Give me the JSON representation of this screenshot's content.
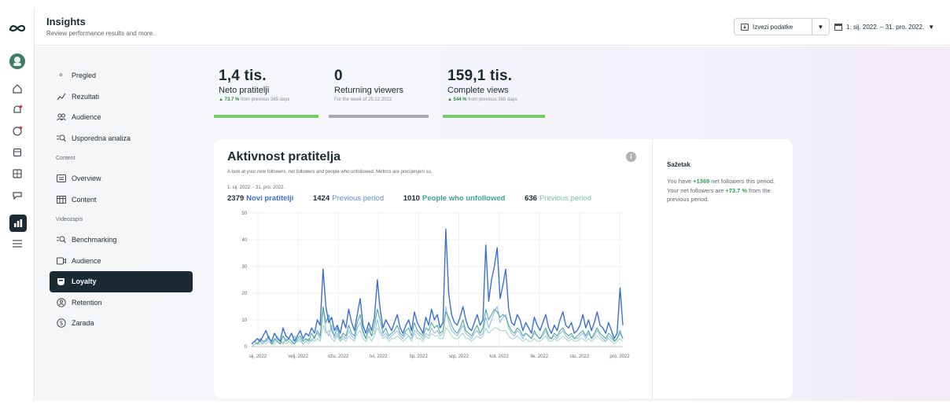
{
  "header": {
    "title": "Insights",
    "subtitle": "Review performance results and more.",
    "export_label": "Izvezi podatke",
    "date_range": "1. sij. 2022. – 31. pro. 2022."
  },
  "rail": {
    "icons": [
      "meta-logo-icon",
      "avatar",
      "home-icon",
      "notifications-icon",
      "chat-icon",
      "posts-icon",
      "content-icon",
      "inbox-icon",
      "insights-icon",
      "menu-icon"
    ]
  },
  "nav": {
    "items": [
      {
        "label": "Pregled",
        "icon": "overview-icon"
      },
      {
        "label": "Rezultati",
        "icon": "results-icon"
      },
      {
        "label": "Audience",
        "icon": "audience-icon"
      },
      {
        "label": "Usporedna analiza",
        "icon": "benchmark-icon"
      }
    ],
    "section_content": "Content",
    "content_items": [
      {
        "label": "Overview",
        "icon": "overview-icon"
      },
      {
        "label": "Content",
        "icon": "table-icon"
      }
    ],
    "section_video": "Videozapis",
    "video_items": [
      {
        "label": "Benchmarking",
        "icon": "benchmark-icon"
      },
      {
        "label": "Audience",
        "icon": "video-audience-icon"
      },
      {
        "label": "Loyalty",
        "icon": "loyalty-icon",
        "active": true
      },
      {
        "label": "Retention",
        "icon": "retention-icon"
      },
      {
        "label": "Zarada",
        "icon": "dollar-icon"
      }
    ]
  },
  "stats": [
    {
      "value": "1,4 tis.",
      "label": "Neto pratitelji",
      "change": "73.7 %",
      "sub": " from previous 365 days",
      "bar_color": "#7bc96f"
    },
    {
      "value": "0",
      "label": "Returning viewers",
      "change": "",
      "sub": "For the week of 25.12.2022",
      "bar_color": "#a7a9ac"
    },
    {
      "value": "159,1 tis.",
      "label": "Complete views",
      "change": "544 %",
      "sub": " from previous 365 days",
      "bar_color": "#7bc96f"
    }
  ],
  "card": {
    "title": "Aktivnost pratitelja",
    "description": "A look at your new followers, net followers and people who unfollowed. Metrics are procijenjeni su.",
    "range": "1. sij. 2022. - 31. pro. 2022.",
    "legend": [
      {
        "value": "2379",
        "label": "Novi pratitelji"
      },
      {
        "value": "1424",
        "label": "Previous period"
      },
      {
        "value": "1010",
        "label": "People who unfollowed"
      },
      {
        "value": "636",
        "label": "Previous period"
      }
    ],
    "info_glyph": "i"
  },
  "summary": {
    "title": "Sažetak",
    "text_1": "You have ",
    "hl_1": "+1369",
    "text_2": " net followers this period. Your net followers are ",
    "hl_2": "+73.7 %",
    "text_3": " from the previous period."
  },
  "chart_data": {
    "type": "line",
    "x": [
      "sij. 2022",
      "velj. 2022",
      "ožu. 2022",
      "tvi. 2022",
      "lip. 2022",
      "srp. 2022",
      "kol. 2022",
      "ile. 2022",
      "stu. 2022",
      "pro. 2022"
    ],
    "ylim": [
      0,
      50
    ],
    "yticks": [
      0,
      10,
      20,
      30,
      40,
      50
    ],
    "grid": true,
    "series": [
      {
        "name": "Novi pratitelji",
        "color": "#3b6fd4",
        "values": [
          1,
          2,
          3,
          2,
          4,
          6,
          3,
          2,
          5,
          3,
          2,
          7,
          4,
          3,
          5,
          2,
          4,
          6,
          3,
          5,
          4,
          7,
          5,
          10,
          8,
          29,
          15,
          9,
          11,
          6,
          8,
          5,
          10,
          7,
          14,
          9,
          6,
          12,
          18,
          8,
          5,
          9,
          6,
          11,
          25,
          14,
          7,
          10,
          8,
          6,
          9,
          12,
          7,
          5,
          8,
          10,
          6,
          13,
          9,
          7,
          5,
          11,
          8,
          14,
          10,
          12,
          7,
          9,
          44,
          20,
          12,
          9,
          8,
          11,
          15,
          10,
          7,
          6,
          9,
          12,
          8,
          10,
          38,
          17,
          25,
          30,
          37,
          18,
          23,
          29,
          14,
          9,
          8,
          12,
          10,
          6,
          9,
          7,
          5,
          11,
          8,
          6,
          9,
          12,
          7,
          5,
          8,
          6,
          10,
          13,
          8,
          7,
          9,
          5,
          6,
          8,
          12,
          7,
          10,
          6,
          9,
          13,
          8,
          7,
          5,
          9,
          6,
          3,
          5,
          22,
          8
        ]
      },
      {
        "name": "Previous period",
        "color": "#8fb4ea",
        "values": [
          0,
          1,
          1,
          2,
          1,
          3,
          2,
          1,
          2,
          4,
          2,
          1,
          3,
          2,
          1,
          4,
          2,
          3,
          1,
          2,
          3,
          2,
          4,
          5,
          3,
          14,
          6,
          4,
          8,
          3,
          5,
          2,
          4,
          3,
          6,
          4,
          3,
          7,
          9,
          5,
          3,
          6,
          4,
          5,
          10,
          6,
          4,
          5,
          3,
          4,
          5,
          6,
          4,
          3,
          5,
          4,
          3,
          6,
          5,
          4,
          3,
          5,
          4,
          7,
          5,
          6,
          4,
          5,
          15,
          9,
          6,
          5,
          4,
          6,
          8,
          5,
          4,
          3,
          5,
          6,
          4,
          5,
          11,
          7,
          10,
          13,
          15,
          9,
          11,
          12,
          7,
          5,
          4,
          6,
          5,
          3,
          5,
          4,
          3,
          5,
          4,
          3,
          4,
          6,
          3,
          3,
          4,
          3,
          5,
          6,
          4,
          3,
          4,
          3,
          3,
          4,
          5,
          3,
          5,
          3,
          4,
          6,
          4,
          3,
          2,
          4,
          3,
          2,
          3,
          5,
          3
        ]
      },
      {
        "name": "People who unfollowed",
        "color": "#3aa38c",
        "values": [
          1,
          2,
          1,
          3,
          2,
          2,
          4,
          1,
          3,
          2,
          1,
          4,
          2,
          3,
          2,
          1,
          3,
          4,
          2,
          3,
          2,
          5,
          3,
          6,
          4,
          15,
          9,
          12,
          6,
          4,
          7,
          3,
          5,
          4,
          8,
          5,
          4,
          9,
          12,
          6,
          3,
          7,
          4,
          8,
          14,
          10,
          5,
          7,
          4,
          5,
          6,
          8,
          5,
          4,
          6,
          7,
          4,
          9,
          6,
          5,
          4,
          7,
          6,
          9,
          7,
          8,
          5,
          6,
          13,
          11,
          8,
          6,
          5,
          7,
          10,
          6,
          5,
          4,
          6,
          8,
          5,
          7,
          14,
          10,
          12,
          14,
          13,
          11,
          12,
          11,
          8,
          6,
          5,
          7,
          6,
          4,
          5,
          4,
          3,
          6,
          4,
          3,
          5,
          7,
          4,
          3,
          5,
          4,
          6,
          7,
          5,
          4,
          5,
          3,
          4,
          5,
          6,
          4,
          6,
          3,
          5,
          7,
          5,
          4,
          3,
          5,
          4,
          2,
          3,
          6,
          3
        ]
      },
      {
        "name": "Previous period",
        "color": "#9fd3c6",
        "values": [
          0,
          1,
          1,
          1,
          2,
          1,
          2,
          1,
          1,
          2,
          1,
          2,
          1,
          2,
          1,
          1,
          2,
          2,
          1,
          2,
          1,
          3,
          2,
          3,
          2,
          8,
          5,
          6,
          3,
          2,
          4,
          2,
          3,
          2,
          4,
          3,
          2,
          5,
          6,
          3,
          2,
          4,
          2,
          4,
          7,
          5,
          3,
          4,
          2,
          3,
          3,
          4,
          3,
          2,
          3,
          4,
          2,
          5,
          3,
          3,
          2,
          4,
          3,
          5,
          4,
          4,
          3,
          3,
          7,
          6,
          4,
          3,
          3,
          4,
          5,
          3,
          3,
          2,
          3,
          4,
          3,
          4,
          7,
          5,
          6,
          7,
          7,
          6,
          6,
          6,
          4,
          3,
          3,
          4,
          3,
          2,
          3,
          2,
          2,
          3,
          2,
          2,
          3,
          4,
          2,
          2,
          3,
          2,
          3,
          4,
          3,
          2,
          3,
          2,
          2,
          3,
          3,
          2,
          3,
          2,
          3,
          4,
          3,
          2,
          2,
          3,
          2,
          1,
          2,
          3,
          2
        ]
      }
    ]
  }
}
